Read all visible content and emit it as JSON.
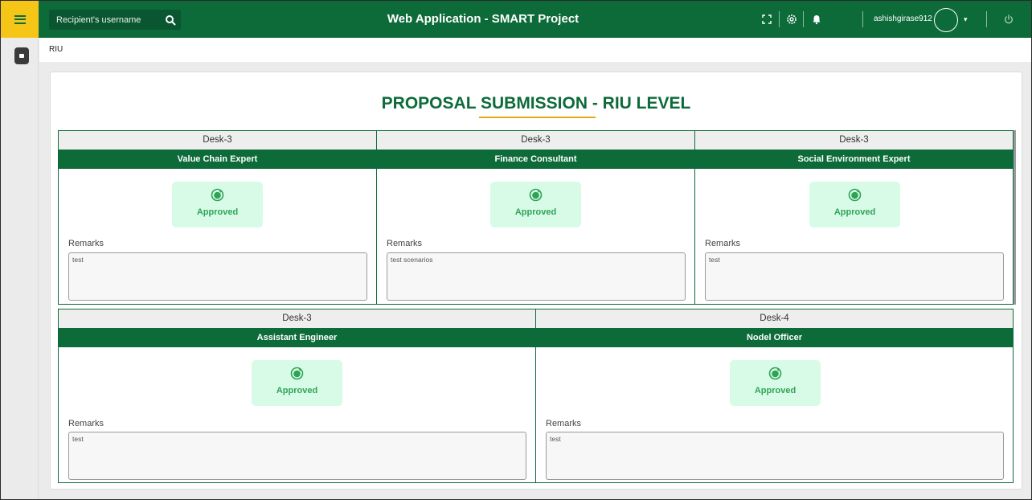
{
  "header": {
    "menu_icon": "hamburger-icon",
    "search_placeholder": "Recipient's username",
    "search_icon": "search-icon",
    "title": "Web Application - SMART Project",
    "icons": [
      "fullscreen-icon",
      "gear-icon",
      "bell-icon",
      "power-icon"
    ],
    "username": "ashishgirase912",
    "caret": "▾"
  },
  "sidebar": {
    "items": [
      {
        "icon": "grid-icon"
      }
    ]
  },
  "breadcrumb": "RIU",
  "page": {
    "title": "PROPOSAL SUBMISSION - RIU LEVEL",
    "remarks_label": "Remarks",
    "status_label": "Approved",
    "desks": [
      {
        "desk": "Desk-3",
        "role": "Value Chain Expert",
        "status": "Approved",
        "remarks": "test"
      },
      {
        "desk": "Desk-3",
        "role": "Finance Consultant",
        "status": "Approved",
        "remarks": "test scenarios"
      },
      {
        "desk": "Desk-3",
        "role": "Social Environment Expert",
        "status": "Approved",
        "remarks": "test"
      },
      {
        "desk": "Desk-3",
        "role": "Assistant Engineer",
        "status": "Approved",
        "remarks": "test"
      },
      {
        "desk": "Desk-4",
        "role": "Nodel Officer",
        "status": "Approved",
        "remarks": "test"
      }
    ]
  },
  "colors": {
    "brand_green": "#0d6b3a",
    "accent_yellow": "#f5c518",
    "approved_bg": "#d8fbe8",
    "approved_text": "#2ea356",
    "underline_gold": "#e4a91a"
  }
}
